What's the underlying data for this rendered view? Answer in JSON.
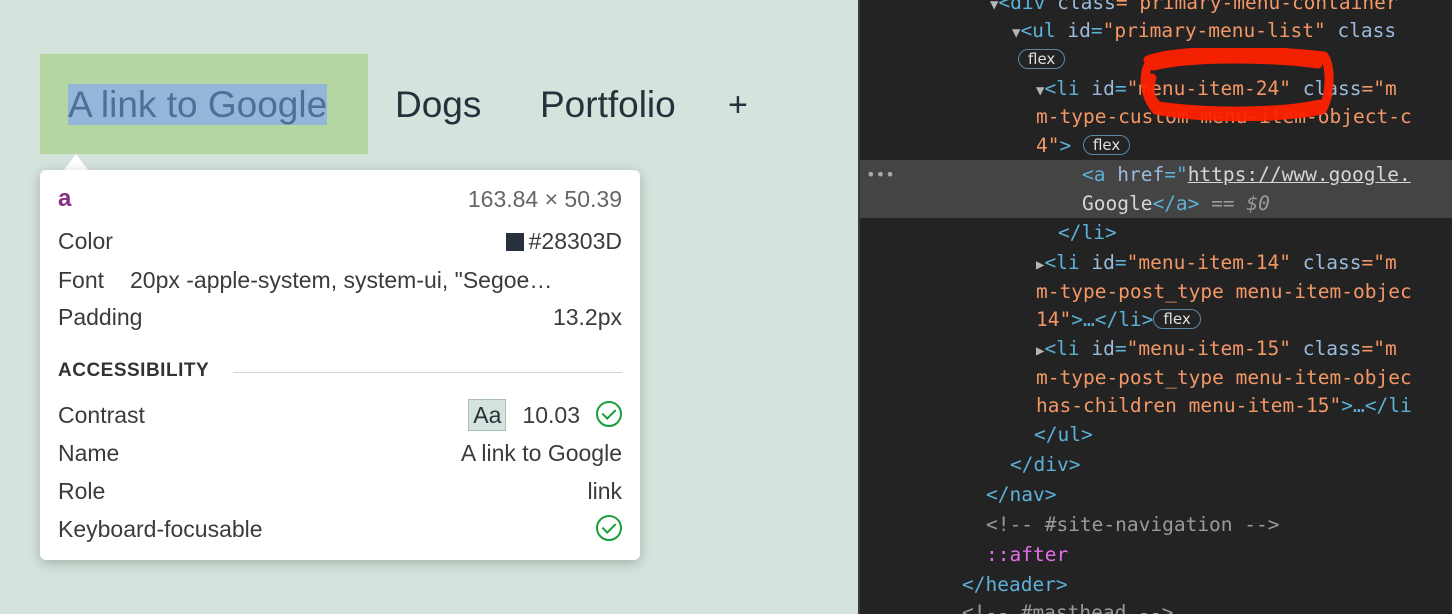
{
  "page": {
    "nav": {
      "link_google": "A link to Google",
      "dogs": "Dogs",
      "portfolio": "Portfolio",
      "plus": "+"
    }
  },
  "tooltip": {
    "tag": "a",
    "dimensions": "163.84 × 50.39",
    "color_label": "Color",
    "color_value": "#28303D",
    "font_label": "Font",
    "font_value": "20px -apple-system, system-ui, \"Segoe…",
    "padding_label": "Padding",
    "padding_value": "13.2px",
    "section_title": "ACCESSIBILITY",
    "contrast_label": "Contrast",
    "contrast_aa": "Aa",
    "contrast_value": "10.03",
    "name_label": "Name",
    "name_value": "A link to Google",
    "role_label": "Role",
    "role_value": "link",
    "keyboard_label": "Keyboard-focusable"
  },
  "devtools": {
    "l0_a": "<div ",
    "l0_b": "class",
    "l0_c": "=\"primary-menu-container",
    "l1_tag": "<ul ",
    "l1_attr1": "id",
    "l1_val1": "\"primary-menu-list\"",
    "l1_attr2": " class",
    "flex": "flex",
    "l3_tag": "<li ",
    "l3_attr1": "id",
    "l3_val1": "\"menu-item-24\"",
    "l3_attr2": " class",
    "l3_val2": "=\"m",
    "l4_val": "m-type-custom menu-item-object-c",
    "l5_val": "4\"",
    "l5_close": ">",
    "l6_tag": "<a ",
    "l6_attr": "href",
    "l6_eq": "=\"",
    "l6_href": "https://www.google.",
    "l7_text": "Google",
    "l7_close": "</a>",
    "l7_eq": " == ",
    "l7_dollar": "$0",
    "l8": "</li>",
    "l9_tag": "<li ",
    "l9_attr1": "id",
    "l9_val1": "\"menu-item-14\"",
    "l9_attr2": " class",
    "l9_val2": "=\"m",
    "l10_val": "m-type-post_type menu-item-objec",
    "l11_val": "14\"",
    "l11_rest": ">…</li>",
    "l12_tag": "<li ",
    "l12_attr1": "id",
    "l12_val1": "\"menu-item-15\"",
    "l12_attr2": " class",
    "l12_val2": "=\"m",
    "l13_val": "m-type-post_type menu-item-objec",
    "l14_val": "has-children menu-item-15\"",
    "l14_rest": ">…</li",
    "l15": "</ul>",
    "l16": "</div>",
    "l17": "</nav>",
    "l18": "<!-- #site-navigation -->",
    "l19": "::after",
    "l20": "</header>",
    "l21": "<!-- #masthead -->"
  },
  "colors": {
    "page_bg": "#d4e3dc",
    "highlight": "#b3d6a3",
    "selection": "#94b6d8",
    "text": "#28303d",
    "devtools_bg": "#232323",
    "annotation_red": "#ff2200"
  }
}
